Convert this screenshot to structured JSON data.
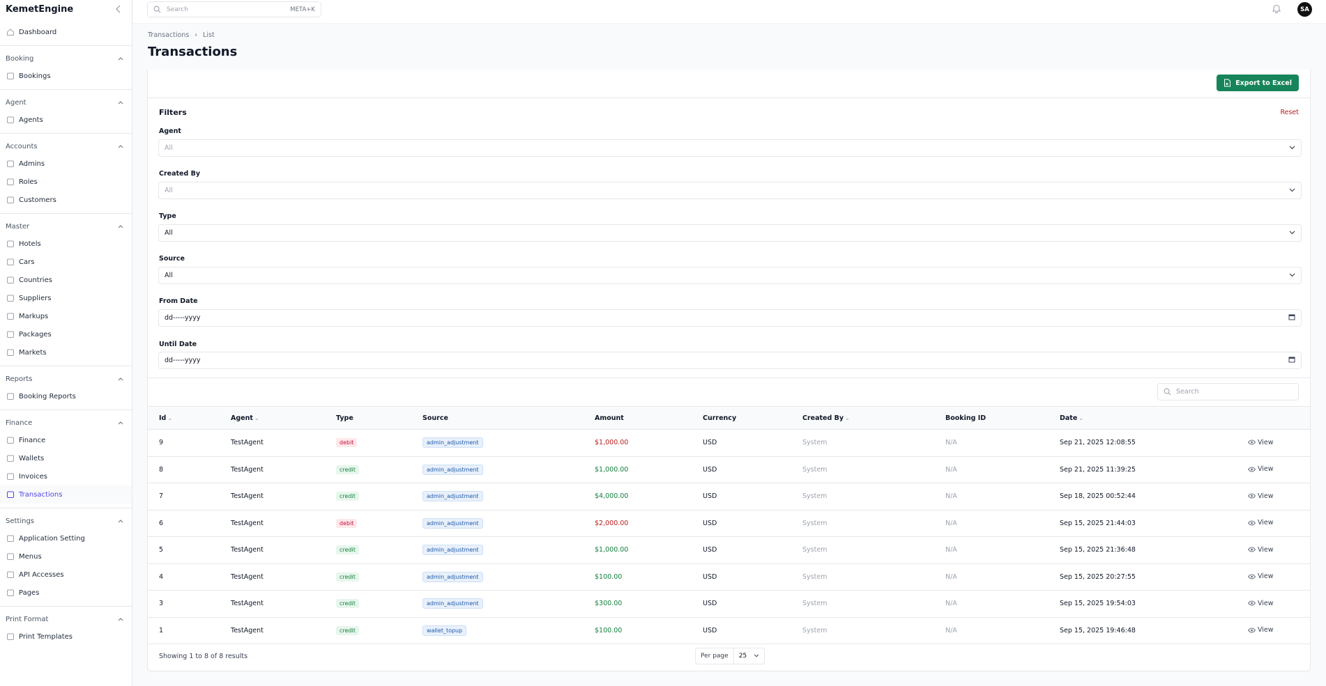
{
  "app": {
    "name": "KemetEngine"
  },
  "sidebar": {
    "dashboard": "Dashboard",
    "groups": [
      {
        "title": "Booking",
        "items": [
          {
            "label": "Bookings",
            "icon": "calendar-icon"
          }
        ]
      },
      {
        "title": "Agent",
        "items": [
          {
            "label": "Agents",
            "icon": "user-circle-icon"
          }
        ]
      },
      {
        "title": "Accounts",
        "items": [
          {
            "label": "Admins",
            "icon": "users-icon"
          },
          {
            "label": "Roles",
            "icon": "shield-icon"
          },
          {
            "label": "Customers",
            "icon": "user-circle-icon"
          }
        ]
      },
      {
        "title": "Master",
        "items": [
          {
            "label": "Hotels",
            "icon": "building-icon"
          },
          {
            "label": "Cars",
            "icon": "car-icon"
          },
          {
            "label": "Countries",
            "icon": "globe-icon"
          },
          {
            "label": "Suppliers",
            "icon": "truck-icon"
          },
          {
            "label": "Markups",
            "icon": "tag-icon"
          },
          {
            "label": "Packages",
            "icon": "box-icon"
          },
          {
            "label": "Markets",
            "icon": "store-icon"
          }
        ]
      },
      {
        "title": "Reports",
        "items": [
          {
            "label": "Booking Reports",
            "icon": "bar-chart-icon"
          }
        ]
      },
      {
        "title": "Finance",
        "items": [
          {
            "label": "Finance",
            "icon": "banknote-icon"
          },
          {
            "label": "Wallets",
            "icon": "wallet-icon"
          },
          {
            "label": "Invoices",
            "icon": "document-icon"
          },
          {
            "label": "Transactions",
            "icon": "arrows-exchange-icon",
            "active": true
          }
        ]
      },
      {
        "title": "Settings",
        "items": [
          {
            "label": "Application Setting",
            "icon": "gear-icon"
          },
          {
            "label": "Menus",
            "icon": "menu-icon"
          },
          {
            "label": "API Accesses",
            "icon": "key-icon"
          },
          {
            "label": "Pages",
            "icon": "folder-icon"
          }
        ]
      },
      {
        "title": "Print Format",
        "items": [
          {
            "label": "Print Templates",
            "icon": "printer-icon"
          }
        ]
      }
    ]
  },
  "topbar": {
    "search_placeholder": "Search",
    "shortcut": "META+K",
    "avatar_initials": "SA"
  },
  "breadcrumb": {
    "parent": "Transactions",
    "current": "List"
  },
  "page": {
    "title": "Transactions"
  },
  "actions": {
    "export_label": "Export to Excel"
  },
  "filters": {
    "title": "Filters",
    "reset": "Reset",
    "agent": {
      "label": "Agent",
      "value": "All"
    },
    "created_by": {
      "label": "Created By",
      "value": "All"
    },
    "type": {
      "label": "Type",
      "value": "All"
    },
    "source": {
      "label": "Source",
      "value": "All"
    },
    "from_date": {
      "label": "From Date",
      "value": "dd-----yyyy"
    },
    "until_date": {
      "label": "Until Date",
      "value": "dd-----yyyy"
    }
  },
  "table": {
    "search_placeholder": "Search",
    "columns": [
      "Id",
      "Agent",
      "Type",
      "Source",
      "Amount",
      "Currency",
      "Created By",
      "Booking ID",
      "Date"
    ],
    "view_label": "View",
    "rows": [
      {
        "id": "9",
        "agent": "TestAgent",
        "type": "debit",
        "source": "admin_adjustment",
        "amount": "$1,000.00",
        "currency": "USD",
        "created_by": "System",
        "booking_id": "N/A",
        "date": "Sep 21, 2025 12:08:55"
      },
      {
        "id": "8",
        "agent": "TestAgent",
        "type": "credit",
        "source": "admin_adjustment",
        "amount": "$1,000.00",
        "currency": "USD",
        "created_by": "System",
        "booking_id": "N/A",
        "date": "Sep 21, 2025 11:39:25"
      },
      {
        "id": "7",
        "agent": "TestAgent",
        "type": "credit",
        "source": "admin_adjustment",
        "amount": "$4,000.00",
        "currency": "USD",
        "created_by": "System",
        "booking_id": "N/A",
        "date": "Sep 18, 2025 00:52:44"
      },
      {
        "id": "6",
        "agent": "TestAgent",
        "type": "debit",
        "source": "admin_adjustment",
        "amount": "$2,000.00",
        "currency": "USD",
        "created_by": "System",
        "booking_id": "N/A",
        "date": "Sep 15, 2025 21:44:03"
      },
      {
        "id": "5",
        "agent": "TestAgent",
        "type": "credit",
        "source": "admin_adjustment",
        "amount": "$1,000.00",
        "currency": "USD",
        "created_by": "System",
        "booking_id": "N/A",
        "date": "Sep 15, 2025 21:36:48"
      },
      {
        "id": "4",
        "agent": "TestAgent",
        "type": "credit",
        "source": "admin_adjustment",
        "amount": "$100.00",
        "currency": "USD",
        "created_by": "System",
        "booking_id": "N/A",
        "date": "Sep 15, 2025 20:27:55"
      },
      {
        "id": "3",
        "agent": "TestAgent",
        "type": "credit",
        "source": "admin_adjustment",
        "amount": "$300.00",
        "currency": "USD",
        "created_by": "System",
        "booking_id": "N/A",
        "date": "Sep 15, 2025 19:54:03"
      },
      {
        "id": "1",
        "agent": "TestAgent",
        "type": "credit",
        "source": "wallet_topup",
        "amount": "$100.00",
        "currency": "USD",
        "created_by": "System",
        "booking_id": "N/A",
        "date": "Sep 15, 2025 19:46:48"
      }
    ]
  },
  "pagination": {
    "summary": "Showing 1 to 8 of 8 results",
    "per_page_label": "Per page",
    "per_page_value": "25"
  },
  "colors": {
    "accent": "#4f46e5",
    "export": "#17845a",
    "debit": "#b91c1c",
    "credit": "#15803d"
  }
}
